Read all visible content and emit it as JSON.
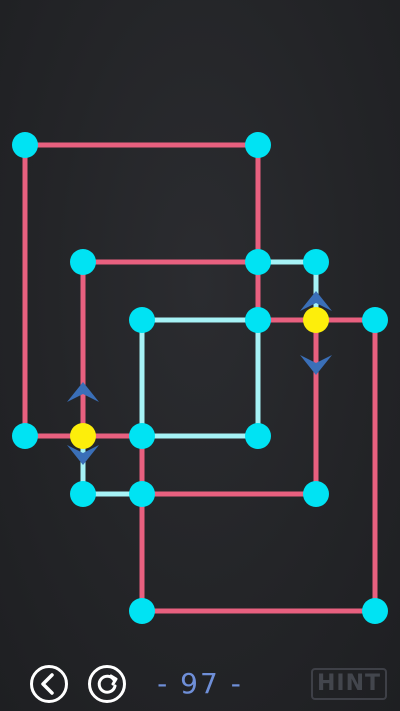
{
  "level": {
    "label": "- 97 -"
  },
  "toolbar": {
    "back_icon": "back-arrow-icon",
    "restart_icon": "restart-icon",
    "hint_label": "HINT"
  },
  "colors": {
    "background": "#232427",
    "pink_line": "#e8607f",
    "light_line": "#a6f2f6",
    "node": "#00e3f3",
    "active_node": "#fdee0b",
    "arrow": "#3a6fb8",
    "level_text": "#6f8fd8",
    "hint_text": "#43464d"
  }
}
